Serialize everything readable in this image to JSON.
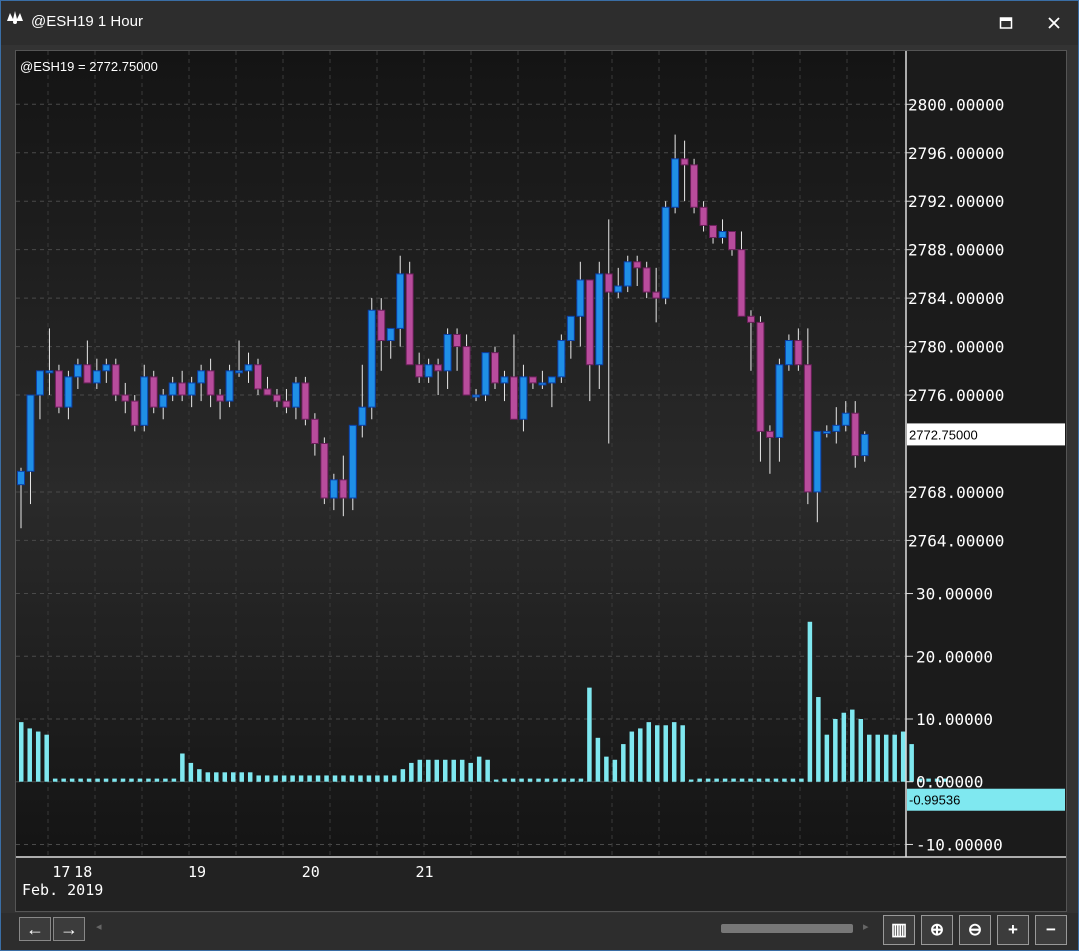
{
  "window": {
    "title": "@ESH19 1 Hour",
    "maximize_icon": "maximize-icon",
    "close_icon": "close-icon"
  },
  "chart_data": [
    {
      "type": "candlestick",
      "symbol_label": "@ESH19 = 2772.75000",
      "last_value_label": "2772.75000",
      "last_value": 2772.75,
      "y_ticks": [
        "2800.00000",
        "2796.00000",
        "2792.00000",
        "2788.00000",
        "2784.00000",
        "2780.00000",
        "2776.00000",
        "2768.00000",
        "2764.00000"
      ],
      "y_tick_values": [
        2800,
        2796,
        2792,
        2788,
        2784,
        2780,
        2776,
        2768,
        2764
      ],
      "ylim": [
        2762.3,
        2804.4
      ],
      "x_tick_labels": [
        "17",
        "18",
        "19",
        "20",
        "21"
      ],
      "x_tick_index": [
        1.2,
        3.5,
        15.5,
        27.5,
        39.5
      ],
      "x_sublabel": "Feb. 2019",
      "up_color": "#1f8fe6",
      "down_color": "#b84c9c",
      "grid": true,
      "candles": [
        [
          2768.6,
          2770.0,
          2765.0,
          2769.7
        ],
        [
          2769.7,
          2776.0,
          2767.0,
          2776.0
        ],
        [
          2776.0,
          2778.0,
          2774.0,
          2778.0
        ],
        [
          2778.0,
          2781.5,
          2776.0,
          2778.0
        ],
        [
          2778.0,
          2778.5,
          2774.5,
          2775.0
        ],
        [
          2775.0,
          2778.0,
          2774.0,
          2777.5
        ],
        [
          2777.5,
          2779.0,
          2776.5,
          2778.5
        ],
        [
          2778.5,
          2780.5,
          2777.0,
          2777.0
        ],
        [
          2777.0,
          2779.0,
          2776.5,
          2778.0
        ],
        [
          2778.0,
          2779.0,
          2777.0,
          2778.5
        ],
        [
          2778.5,
          2779.0,
          2775.5,
          2776.0
        ],
        [
          2776.0,
          2777.0,
          2774.5,
          2775.5
        ],
        [
          2775.5,
          2776.0,
          2773.0,
          2773.5
        ],
        [
          2773.5,
          2778.5,
          2773.0,
          2777.5
        ],
        [
          2777.5,
          2778.0,
          2774.5,
          2775.0
        ],
        [
          2775.0,
          2776.5,
          2774.0,
          2776.0
        ],
        [
          2776.0,
          2777.5,
          2775.5,
          2777.0
        ],
        [
          2777.0,
          2778.0,
          2775.5,
          2776.0
        ],
        [
          2776.0,
          2777.5,
          2775.0,
          2777.0
        ],
        [
          2777.0,
          2778.5,
          2775.5,
          2778.0
        ],
        [
          2778.0,
          2779.0,
          2775.0,
          2776.0
        ],
        [
          2776.0,
          2776.5,
          2774.0,
          2775.5
        ],
        [
          2775.5,
          2778.5,
          2775.0,
          2778.0
        ],
        [
          2778.0,
          2780.5,
          2777.5,
          2778.0
        ],
        [
          2778.0,
          2779.5,
          2777.0,
          2778.5
        ],
        [
          2778.5,
          2779.0,
          2776.0,
          2776.5
        ],
        [
          2776.5,
          2777.5,
          2776.0,
          2776.0
        ],
        [
          2776.0,
          2776.5,
          2775.0,
          2775.5
        ],
        [
          2775.5,
          2776.5,
          2774.5,
          2775.0
        ],
        [
          2775.0,
          2777.5,
          2774.0,
          2777.0
        ],
        [
          2777.0,
          2777.5,
          2773.5,
          2774.0
        ],
        [
          2774.0,
          2774.5,
          2771.0,
          2772.0
        ],
        [
          2772.0,
          2772.5,
          2767.0,
          2767.5
        ],
        [
          2767.5,
          2769.5,
          2766.5,
          2769.0
        ],
        [
          2769.0,
          2771.0,
          2766.0,
          2767.5
        ],
        [
          2767.5,
          2773.5,
          2766.5,
          2773.5
        ],
        [
          2773.5,
          2778.5,
          2772.5,
          2775.0
        ],
        [
          2775.0,
          2784.0,
          2774.0,
          2783.0
        ],
        [
          2783.0,
          2784.0,
          2778.0,
          2780.5
        ],
        [
          2780.5,
          2781.0,
          2779.0,
          2781.5
        ],
        [
          2781.5,
          2787.5,
          2780.0,
          2786.0
        ],
        [
          2786.0,
          2787.0,
          2778.5,
          2778.5
        ],
        [
          2778.5,
          2779.5,
          2777.0,
          2777.5
        ],
        [
          2777.5,
          2779.0,
          2777.0,
          2778.5
        ],
        [
          2778.5,
          2779.0,
          2776.0,
          2778.0
        ],
        [
          2778.0,
          2781.5,
          2776.5,
          2781.0
        ],
        [
          2781.0,
          2781.5,
          2778.0,
          2780.0
        ],
        [
          2780.0,
          2781.0,
          2776.0,
          2776.0
        ],
        [
          2776.0,
          2776.5,
          2775.5,
          2776.0
        ],
        [
          2776.0,
          2779.5,
          2775.5,
          2779.5
        ],
        [
          2779.5,
          2780.0,
          2776.5,
          2777.0
        ],
        [
          2777.0,
          2778.0,
          2775.5,
          2777.5
        ],
        [
          2777.5,
          2781.0,
          2774.0,
          2774.0
        ],
        [
          2774.0,
          2778.5,
          2773.0,
          2777.5
        ],
        [
          2777.5,
          2777.5,
          2776.5,
          2777.0
        ],
        [
          2777.0,
          2778.0,
          2776.5,
          2777.0
        ],
        [
          2777.0,
          2777.5,
          2775.0,
          2777.5
        ],
        [
          2777.5,
          2781.0,
          2777.0,
          2780.5
        ],
        [
          2780.5,
          2782.5,
          2779.0,
          2782.5
        ],
        [
          2782.5,
          2787.0,
          2780.0,
          2785.5
        ],
        [
          2785.5,
          2784.0,
          2775.5,
          2778.5
        ],
        [
          2778.5,
          2787.0,
          2776.5,
          2786.0
        ],
        [
          2786.0,
          2790.5,
          2772.0,
          2784.5
        ],
        [
          2784.5,
          2786.5,
          2784.0,
          2785.0
        ],
        [
          2785.0,
          2787.5,
          2784.5,
          2787.0
        ],
        [
          2787.0,
          2787.5,
          2785.0,
          2786.5
        ],
        [
          2786.5,
          2787.0,
          2784.0,
          2784.5
        ],
        [
          2784.5,
          2786.5,
          2782.0,
          2784.0
        ],
        [
          2784.0,
          2792.0,
          2783.5,
          2791.5
        ],
        [
          2791.5,
          2797.5,
          2791.0,
          2795.5
        ],
        [
          2795.5,
          2797.0,
          2792.0,
          2795.0
        ],
        [
          2795.0,
          2795.5,
          2791.0,
          2791.5
        ],
        [
          2791.5,
          2792.0,
          2789.5,
          2790.0
        ],
        [
          2790.0,
          2790.0,
          2788.5,
          2789.0
        ],
        [
          2789.0,
          2790.5,
          2788.5,
          2789.5
        ],
        [
          2789.5,
          2789.5,
          2787.5,
          2788.0
        ],
        [
          2788.0,
          2789.5,
          2786.0,
          2782.5
        ],
        [
          2782.5,
          2783.0,
          2778.0,
          2782.0
        ],
        [
          2782.0,
          2782.5,
          2770.5,
          2773.0
        ],
        [
          2773.0,
          2773.5,
          2769.5,
          2772.5
        ],
        [
          2772.5,
          2779.0,
          2770.5,
          2778.5
        ],
        [
          2778.5,
          2781.0,
          2778.0,
          2780.5
        ],
        [
          2780.5,
          2781.5,
          2778.0,
          2778.5
        ],
        [
          2778.5,
          2781.5,
          2767.0,
          2768.0
        ],
        [
          2768.0,
          2772.5,
          2765.5,
          2773.0
        ],
        [
          2773.0,
          2773.5,
          2772.5,
          2773.0
        ],
        [
          2773.0,
          2775.0,
          2772.0,
          2773.5
        ],
        [
          2773.5,
          2775.5,
          2773.0,
          2774.5
        ],
        [
          2774.5,
          2775.5,
          2770.0,
          2771.0
        ],
        [
          2771.0,
          2773.0,
          2770.5,
          2772.75
        ]
      ]
    },
    {
      "type": "bar",
      "y_ticks": [
        "30.00000",
        "20.00000",
        "10.00000",
        "0.00000",
        "-10.00000"
      ],
      "y_tick_values": [
        30,
        20,
        10,
        0,
        -10
      ],
      "ylim": [
        -12,
        32
      ],
      "last_value_label": "-0.99536",
      "last_value": -0.99536,
      "bar_color": "#7fe8f0",
      "values": [
        9.5,
        8.5,
        8.0,
        7.5,
        0.5,
        0.5,
        0.5,
        0.5,
        0.5,
        0.5,
        0.5,
        0.5,
        0.5,
        0.5,
        0.5,
        0.5,
        0.5,
        0.5,
        0.5,
        4.5,
        3.0,
        2.0,
        1.5,
        1.5,
        1.5,
        1.5,
        1.5,
        1.5,
        1.0,
        1.0,
        1.0,
        1.0,
        1.0,
        1.0,
        1.0,
        1.0,
        1.0,
        1.0,
        1.0,
        1.0,
        1.0,
        1.0,
        1.0,
        1.0,
        1.0,
        2.0,
        3.0,
        3.5,
        3.5,
        3.5,
        3.5,
        3.5,
        3.5,
        3.0,
        4.0,
        3.5,
        0.0,
        0.5,
        0.5,
        0.5,
        0.5,
        0.5,
        0.5,
        0.5,
        0.5,
        0.5,
        0.5,
        15.0,
        7.0,
        4.0,
        3.5,
        6.0,
        8.0,
        8.5,
        9.5,
        9.0,
        9.0,
        9.5,
        9.0,
        0.0,
        0.5,
        0.5,
        0.5,
        0.5,
        0.5,
        0.5,
        0.5,
        0.5,
        0.5,
        0.5,
        0.5,
        0.5,
        0.5,
        25.5,
        13.5,
        7.5,
        10.0,
        11.0,
        11.5,
        10.0,
        7.5,
        7.5,
        7.5,
        7.5,
        8.0,
        6.0,
        0.5,
        0.5,
        0.5,
        0.5
      ]
    }
  ],
  "bottombar": {
    "back_icon": "arrow-left-icon",
    "forward_icon": "arrow-right-icon",
    "back_glyph": "←",
    "forward_glyph": "→",
    "scroll_left_glyph": "◂",
    "scroll_right_glyph": "▸",
    "tools": [
      {
        "name": "data-window-icon",
        "glyph": "▥"
      },
      {
        "name": "zoom-in-icon",
        "glyph": "⊕"
      },
      {
        "name": "zoom-out-icon",
        "glyph": "⊖"
      },
      {
        "name": "plus-icon",
        "glyph": "+"
      },
      {
        "name": "minus-icon",
        "glyph": "−"
      }
    ]
  }
}
